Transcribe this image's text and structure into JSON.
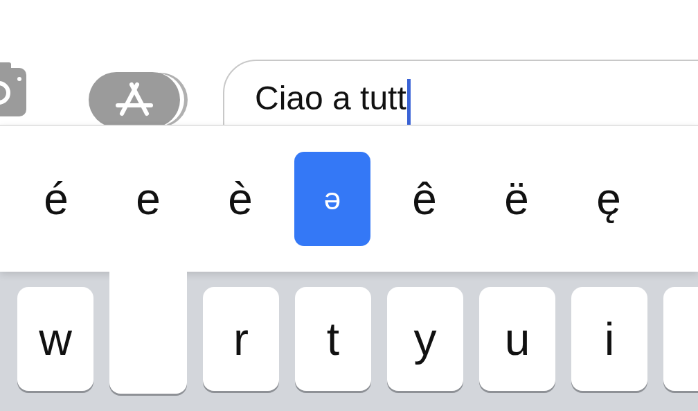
{
  "message_bar": {
    "field": {
      "value": "Ciao a tutt",
      "focused": true
    }
  },
  "accent_popup": {
    "options": [
      {
        "label": "é",
        "selected": false
      },
      {
        "label": "e",
        "selected": false
      },
      {
        "label": "è",
        "selected": false
      },
      {
        "label": "ə",
        "selected": true
      },
      {
        "label": "ê",
        "selected": false
      },
      {
        "label": "ë",
        "selected": false
      },
      {
        "label": "ę",
        "selected": false
      }
    ]
  },
  "keyboard": {
    "keys": [
      {
        "kind": "key",
        "label": "w"
      },
      {
        "kind": "stem"
      },
      {
        "kind": "key",
        "label": "r"
      },
      {
        "kind": "key",
        "label": "t"
      },
      {
        "kind": "key",
        "label": "y"
      },
      {
        "kind": "key",
        "label": "u"
      },
      {
        "kind": "key",
        "label": "i"
      },
      {
        "kind": "key"
      }
    ]
  }
}
